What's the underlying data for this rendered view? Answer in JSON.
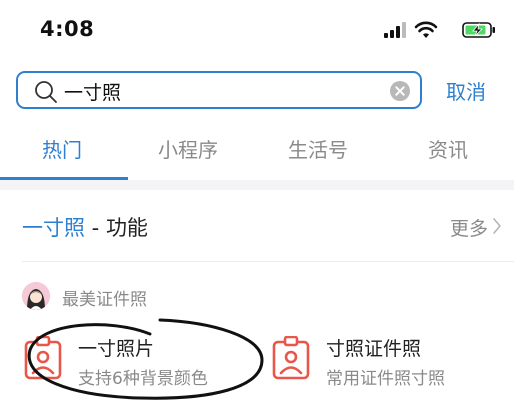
{
  "status_bar": {
    "time": "4:08"
  },
  "search": {
    "value": "一寸照",
    "placeholder": "",
    "cancel_label": "取消"
  },
  "tabs": [
    {
      "label": "热门",
      "active": true
    },
    {
      "label": "小程序",
      "active": false
    },
    {
      "label": "生活号",
      "active": false
    },
    {
      "label": "资讯",
      "active": false
    }
  ],
  "section": {
    "keyword": "一寸照",
    "separator": " - ",
    "title": "功能",
    "more_label": "更多"
  },
  "provider": {
    "name": "最美证件照"
  },
  "results": [
    {
      "title": "一寸照片",
      "subtitle": "支持6种背景颜色"
    },
    {
      "title": "寸照证件照",
      "subtitle": "常用证件照寸照"
    }
  ],
  "colors": {
    "accent": "#2f7fcf",
    "icon_red": "#e8574a",
    "battery_green": "#4cd964",
    "muted": "#8a8a8a"
  }
}
